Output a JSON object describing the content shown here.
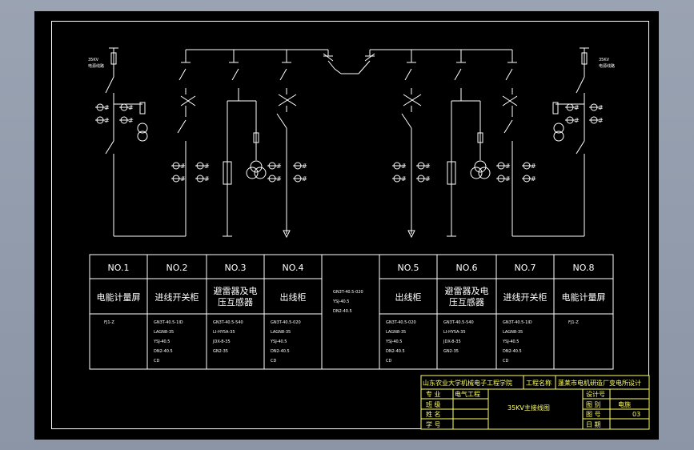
{
  "table": {
    "headers": [
      "NO.1",
      "NO.2",
      "NO.3",
      "NO.4",
      "",
      "NO.5",
      "NO.6",
      "NO.7",
      "NO.8"
    ],
    "names": [
      "电能计量屏",
      "进线开关柜",
      "避雷器及电\n压互感器",
      "出线柜",
      "",
      "出线柜",
      "避雷器及电\n压互感器",
      "进线开关柜",
      "电能计量屏"
    ],
    "specs": [
      [
        "FJ1-Z"
      ],
      [
        "GN3T-40.5-1ID",
        "LAGN8-35",
        "YSJ-40.5",
        "DN2-40.5",
        "CD"
      ],
      [
        "GN3T-40.5-540",
        "LI-HY5A-35",
        "JDX-8-35",
        "GN2-35"
      ],
      [
        "GN3T-40.5-020",
        "LAGN8-35",
        "YSJ-40.5",
        "DN2-40.5",
        "CD"
      ],
      [
        "GN3T-40.5-020",
        "YSJ-40.5",
        "DN2-40.5"
      ],
      [
        "GN3T-40.5-020",
        "LAGN8-35",
        "YSJ-40.5",
        "DN2-40.5",
        "CD"
      ],
      [
        "GN3T-40.5-540",
        "LI-HY5A-35",
        "JDX-8-35",
        "GN2-35"
      ],
      [
        "GN3T-40.5-1ID",
        "LAGN8-35",
        "YSJ-40.5",
        "DN2-40.5",
        "CD"
      ],
      [
        "FJ1-Z"
      ]
    ]
  },
  "diagram": {
    "left_incoming_label": [
      "35KV",
      "电源线路"
    ],
    "right_incoming_label": [
      "35KV",
      "电源线路"
    ]
  },
  "title_block": {
    "school": "山东农业大学机械电子工程学院",
    "project_label": "工程名称",
    "project_name": "蓬莱市电机研造厂变电所设计",
    "major_label": "专  业",
    "major_value": "电气工程",
    "class_label": "班  级",
    "name_label": "姓  名",
    "student_no_label": "学  号",
    "drawing_title": "35KV主接线图",
    "design_no_label": "设计号",
    "category_label": "图  别",
    "category_value": "电施",
    "drawing_no_label": "图  号",
    "drawing_no_value": "03",
    "date_label": "日  期"
  }
}
